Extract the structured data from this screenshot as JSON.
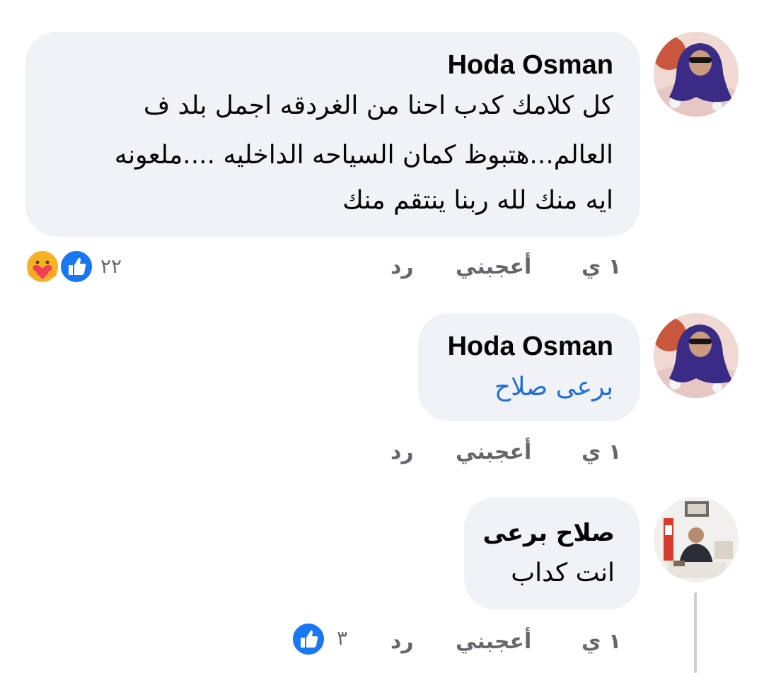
{
  "comments": [
    {
      "author": "Hoda Osman",
      "lines": [
        "كل كلامك كدب احنا من الغردقه اجمل بلد ف",
        "العالم...هتبوظ كمان السياحه الداخليه ....ملعونه",
        "ايه منك لله ربنا ينتقم منك"
      ],
      "time": "١ ي",
      "like_label": "أعجبني",
      "reply_label": "رد",
      "reaction_count": "٢٢",
      "reactions": [
        "like-icon",
        "care-icon"
      ]
    },
    {
      "author": "Hoda Osman",
      "mention": "برعى صلاح",
      "time": "١ ي",
      "like_label": "أعجبني",
      "reply_label": "رد"
    },
    {
      "author": "صلاح برعى",
      "text": "انت كداب",
      "time": "١ ي",
      "like_label": "أعجبني",
      "reply_label": "رد",
      "reaction_count": "٣",
      "reactions": [
        "like-icon"
      ]
    }
  ],
  "colors": {
    "bubble": "#f0f2f5",
    "mention": "#216fdb",
    "meta": "#65676b",
    "like": "#1877f2"
  }
}
